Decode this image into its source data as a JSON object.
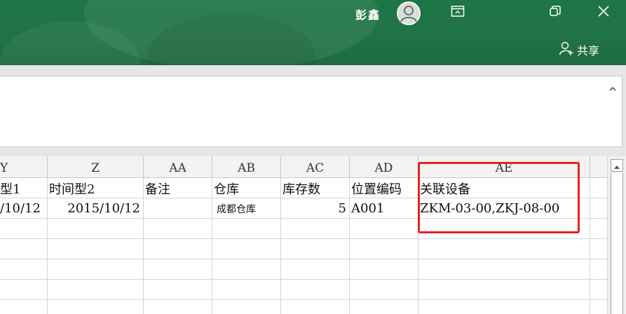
{
  "titlebar": {
    "user_name": "彭鑫",
    "share_label": "共享",
    "icons": {
      "avatar": "avatar-person-icon",
      "ribbon_display": "ribbon-display-options-icon",
      "restore": "restore-window-icon",
      "close": "close-icon",
      "share": "share-person-plus-icon"
    },
    "brand_color": "#217346"
  },
  "ribbon": {
    "collapse_icon": "chevron-up-icon"
  },
  "spreadsheet": {
    "columns": [
      {
        "letter": "Y"
      },
      {
        "letter": "Z"
      },
      {
        "letter": "AA"
      },
      {
        "letter": "AB"
      },
      {
        "letter": "AC"
      },
      {
        "letter": "AD"
      },
      {
        "letter": "AE"
      }
    ],
    "header_row": [
      "型1",
      "时间型2",
      "备注",
      "仓库",
      "库存数",
      "位置编码",
      "关联设备"
    ],
    "data_row": [
      "/10/12",
      "2015/10/12",
      "",
      "成都仓库",
      "5",
      "A001",
      "ZKM-03-00,ZKJ-08-00"
    ]
  },
  "annotation": {
    "highlight_color": "#e8231e"
  }
}
